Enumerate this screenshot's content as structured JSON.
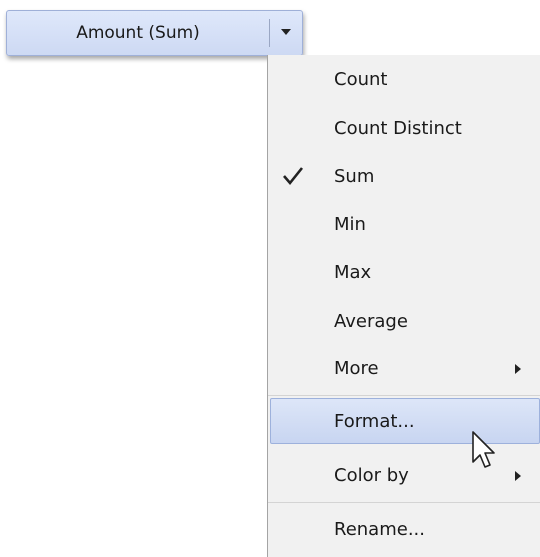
{
  "pill": {
    "label": "Amount (Sum)",
    "dropdown_icon": "caret-down-icon"
  },
  "menu": {
    "items": [
      {
        "label": "Count",
        "checked": false
      },
      {
        "label": "Count Distinct",
        "checked": false
      },
      {
        "label": "Sum",
        "checked": true
      },
      {
        "label": "Min",
        "checked": false
      },
      {
        "label": "Max",
        "checked": false
      },
      {
        "label": "Average",
        "checked": false
      },
      {
        "label": "More",
        "submenu": true
      },
      {
        "label": "Format...",
        "highlighted": true
      },
      {
        "label": "Color by",
        "submenu": true
      },
      {
        "label": "Rename..."
      }
    ]
  },
  "colors": {
    "pill_bg": "#d6e0f7",
    "menu_bg": "#f1f1f1",
    "highlight_bg": "#cdd9f3"
  }
}
